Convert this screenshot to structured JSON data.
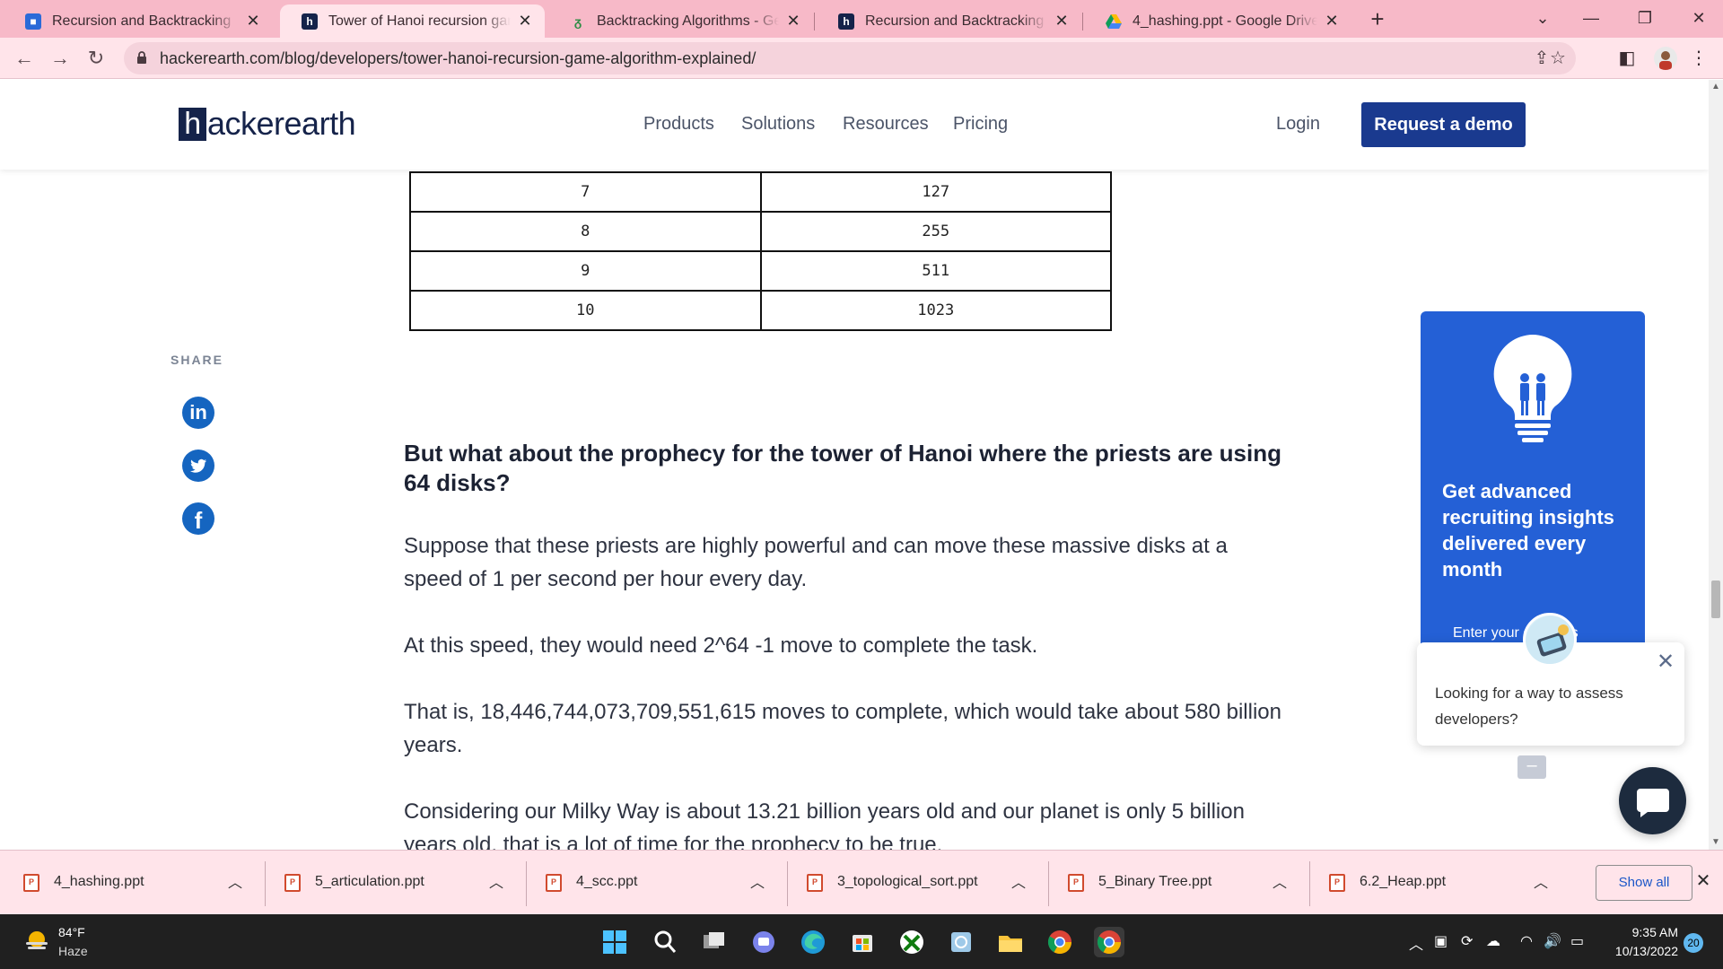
{
  "browser": {
    "tabs": [
      {
        "title": "Recursion and Backtracking",
        "favicon": "classroom-icon",
        "active": false
      },
      {
        "title": "Tower of Hanoi recursion game a",
        "favicon": "hackerearth-icon",
        "active": true
      },
      {
        "title": "Backtracking Algorithms - Geeks",
        "favicon": "geeksforgeeks-icon",
        "active": false
      },
      {
        "title": "Recursion and Backtracking Tuto",
        "favicon": "hackerearth-icon",
        "active": false
      },
      {
        "title": "4_hashing.ppt - Google Drive",
        "favicon": "google-drive-icon",
        "active": false
      }
    ],
    "url": "hackerearth.com/blog/developers/tower-hanoi-recursion-game-algorithm-explained/"
  },
  "site": {
    "logo_box": "h",
    "logo_text": "ackerearth",
    "nav": [
      "Products",
      "Solutions",
      "Resources",
      "Pricing"
    ],
    "login": "Login",
    "demo_button": "Request a demo"
  },
  "table": {
    "rows": [
      [
        "7",
        "127"
      ],
      [
        "8",
        "255"
      ],
      [
        "9",
        "511"
      ],
      [
        "10",
        "1023"
      ]
    ]
  },
  "share": {
    "label": "SHARE",
    "networks": [
      "linkedin-icon",
      "twitter-icon",
      "facebook-icon"
    ]
  },
  "article": {
    "heading": "But what about the prophecy for the tower of Hanoi where the priests are using 64 disks?",
    "paragraphs": [
      "Suppose that these priests are highly powerful and can move these massive disks at a speed of 1 per second per hour every day.",
      "At this speed, they would need 2^64 -1 move to complete the task.",
      "That is, 18,446,744,073,709,551,615 moves to complete, which would take about 580 billion years.",
      "Considering our Milky Way is about 13.21 billion years old and our planet is only 5 billion years old, that is a lot of time for the prophecy to be true."
    ]
  },
  "promo": {
    "title": "Get advanced recruiting insights delivered every month",
    "input_placeholder_visible": "Enter your e   ddress"
  },
  "chat": {
    "message": "Looking for a way to assess developers?",
    "minimize": "–"
  },
  "downloads": {
    "files": [
      "4_hashing.ppt",
      "5_articulation.ppt",
      "4_scc.ppt",
      "3_topological_sort.ppt",
      "5_Binary Tree.ppt",
      "6.2_Heap.ppt"
    ],
    "show_all": "Show all"
  },
  "taskbar": {
    "weather_temp": "84°F",
    "weather_desc": "Haze",
    "time": "9:35 AM",
    "date": "10/13/2022",
    "notifications": "20"
  },
  "colors": {
    "tabstrip": "#f7b9c8",
    "toolbar": "#ffe4ea",
    "brand_navy": "#15234a",
    "demo_button": "#1a3a8f",
    "promo_blue": "#2460d6",
    "social_blue": "#1565c0"
  }
}
